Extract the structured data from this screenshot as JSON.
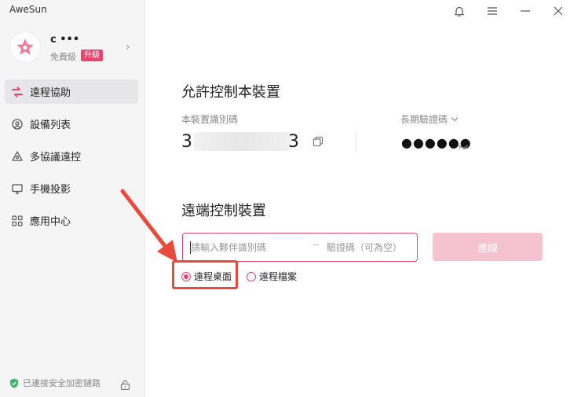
{
  "app": {
    "title": "AweSun"
  },
  "profile": {
    "name": "c        •••",
    "tier": "免費級",
    "upgrade": "升級"
  },
  "sidebar": {
    "items": [
      {
        "label": "遠程協助",
        "icon": "remote-assist-icon",
        "active": true
      },
      {
        "label": "設備列表",
        "icon": "device-list-icon",
        "active": false
      },
      {
        "label": "多協議遠控",
        "icon": "multi-protocol-icon",
        "active": false
      },
      {
        "label": "手機投影",
        "icon": "screen-cast-icon",
        "active": false
      },
      {
        "label": "應用中心",
        "icon": "app-center-icon",
        "active": false
      }
    ],
    "security_status": "已連接安全加密鏈路"
  },
  "allow": {
    "title": "允許控制本裝置",
    "device_id_label": "本裝置識別碼",
    "device_id_prefix": "3",
    "device_id_suffix": "3",
    "password_label": "長期驗證碼",
    "password_mask": "●●●●●●"
  },
  "remote": {
    "title": "遠端控制裝置",
    "partner_placeholder": "請輸入夥伴識別碼",
    "code_placeholder": "驗證碼（可為空）",
    "connect_label": "連線",
    "options": [
      {
        "label": "遠程桌面",
        "checked": true
      },
      {
        "label": "遠程檔案",
        "checked": false
      }
    ]
  },
  "colors": {
    "accent": "#e8456f",
    "connect_disabled": "#f5c3d0",
    "annotation": "#e94a3b",
    "secure": "#3fb56b"
  }
}
